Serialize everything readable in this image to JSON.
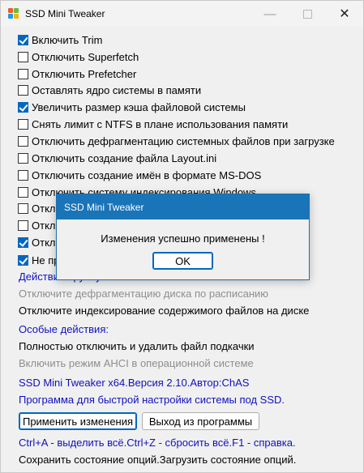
{
  "window": {
    "title": "SSD Mini Tweaker",
    "minimize": "—",
    "maximize": "",
    "close": "✕"
  },
  "options": [
    {
      "label": "Включить Trim",
      "checked": true
    },
    {
      "label": "Отключить Superfetch",
      "checked": false
    },
    {
      "label": "Отключить Prefetcher",
      "checked": false
    },
    {
      "label": "Оставлять ядро системы в памяти",
      "checked": false
    },
    {
      "label": "Увеличить размер кэша файловой системы",
      "checked": true
    },
    {
      "label": "Снять лимит с NTFS в плане использования памяти",
      "checked": false
    },
    {
      "label": "Отключить дефрагментацию системных файлов при загрузке",
      "checked": false
    },
    {
      "label": "Отключить создание файла Layout.ini",
      "checked": false
    },
    {
      "label": "Отключить создание имён в формате MS-DOS",
      "checked": false
    },
    {
      "label": "Отключить систему индексирования Windows",
      "checked": false
    },
    {
      "label": "Откл",
      "checked": false
    },
    {
      "label": "Откл",
      "checked": false
    },
    {
      "label": "Откл",
      "checked": true
    },
    {
      "label": "Не пр",
      "checked": true
    }
  ],
  "manual_actions": {
    "header": "Действия вручную:",
    "items": [
      "Отключите дефрагментацию диска по расписанию",
      "Отключите индексирование содержимого файлов на диске"
    ]
  },
  "special_actions": {
    "header": "Особые действия:",
    "items": [
      "Полностью отключить и удалить файл подкачки",
      "Включить режим AHCI в операционной системе"
    ]
  },
  "about": {
    "version": "SSD Mini Tweaker x64.Версия 2.10.Автор:ChAS",
    "description": "Программа для быстрой настройки системы под SSD."
  },
  "buttons": {
    "apply": "Применить изменения",
    "exit": "Выход из программы"
  },
  "footer": {
    "hotkeys": "Ctrl+A - выделить всё.Ctrl+Z - сбросить всё.F1 - справка.",
    "state": "Сохранить состояние опций.Загрузить состояние опций."
  },
  "dialog": {
    "title": "SSD Mini Tweaker",
    "message": "Изменения успешно применены !",
    "ok": "OK"
  },
  "colors": {
    "link_blue": "#1010c0",
    "disabled_gray": "#8e8e8e",
    "accent": "#0067c0",
    "dialog_title_bg": "#1a74b8"
  }
}
